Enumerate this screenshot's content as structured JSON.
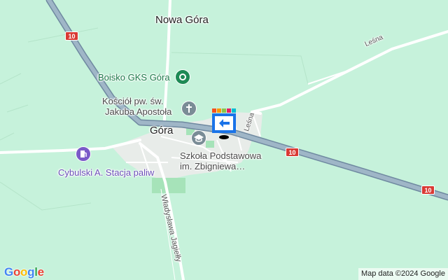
{
  "colors": {
    "land": "#c6f2db",
    "highway": "#8aa4b8",
    "highway_casing": "#6f89a0",
    "road": "#ffffff",
    "builtup": "#e8ece9",
    "park": "#a6e3b9",
    "pin_green": "#1e8a55",
    "pin_grey": "#7a8c96",
    "pin_purple": "#7a5ac8",
    "marker_blue": "#1a73e8"
  },
  "map": {
    "towns": [
      {
        "name": "Nowa Góra"
      },
      {
        "name": "Góra"
      }
    ],
    "pois": [
      {
        "name": "Boisko GKS Góra",
        "icon": "stadium-icon",
        "category": "green"
      },
      {
        "line1": "Kościół pw. św.",
        "line2": "Jakuba Apostoła",
        "icon": "church-cross-icon",
        "category": "grey"
      },
      {
        "line1": "Szkoła Podstawowa",
        "line2": "im. Zbigniewa…",
        "icon": "school-icon",
        "category": "grey"
      },
      {
        "name": "Cybulski A. Stacja paliw",
        "icon": "fuel-pump-icon",
        "category": "purple"
      }
    ],
    "streets": [
      {
        "name": "Leśna"
      },
      {
        "name": "Leśna"
      },
      {
        "name": "Władysława Jagiełły"
      }
    ],
    "route_shields": [
      "10",
      "10",
      "10"
    ]
  },
  "footer": {
    "logo": "Google",
    "attribution": "Map data ©2024 Google"
  }
}
